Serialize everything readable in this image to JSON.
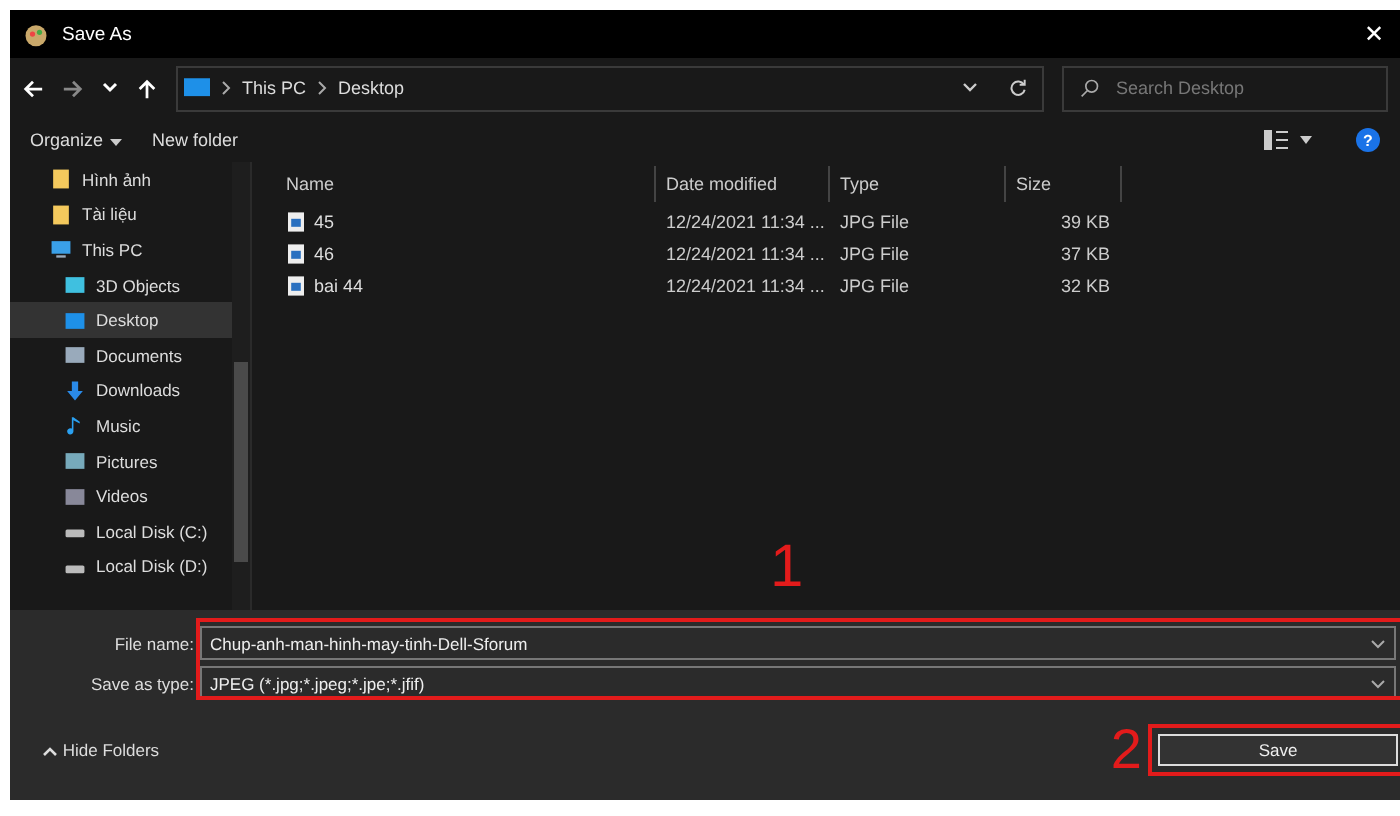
{
  "window": {
    "title": "Save As",
    "close": "✕"
  },
  "address": {
    "path": [
      "This PC",
      "Desktop"
    ],
    "search_placeholder": "Search Desktop"
  },
  "toolbar": {
    "organize": "Organize",
    "new_folder": "New folder",
    "help": "?"
  },
  "sidebar": {
    "items": [
      {
        "label": "Hình ảnh",
        "selected": false
      },
      {
        "label": "Tài liệu",
        "selected": false
      },
      {
        "label": "This PC",
        "selected": false,
        "children": [
          {
            "label": "3D Objects",
            "selected": false
          },
          {
            "label": "Desktop",
            "selected": true
          },
          {
            "label": "Documents",
            "selected": false
          },
          {
            "label": "Downloads",
            "selected": false
          },
          {
            "label": "Music",
            "selected": false
          },
          {
            "label": "Pictures",
            "selected": false
          },
          {
            "label": "Videos",
            "selected": false
          },
          {
            "label": "Local Disk (C:)",
            "selected": false
          },
          {
            "label": "Local Disk (D:)",
            "selected": false
          }
        ]
      }
    ]
  },
  "table": {
    "columns": [
      "Name",
      "Date modified",
      "Type",
      "Size"
    ],
    "rows": [
      {
        "name": "45",
        "date": "12/24/2021 11:34 ...",
        "type": "JPG File",
        "size": "39 KB"
      },
      {
        "name": "46",
        "date": "12/24/2021 11:34 ...",
        "type": "JPG File",
        "size": "37 KB"
      },
      {
        "name": "bai 44",
        "date": "12/24/2021 11:34 ...",
        "type": "JPG File",
        "size": "32 KB"
      }
    ]
  },
  "form": {
    "file_name_label": "File name:",
    "file_name": "Chup-anh-man-hinh-may-tinh-Dell-Sforum",
    "type_label": "Save as type:",
    "type_value": "JPEG (*.jpg;*.jpeg;*.jpe;*.jfif)"
  },
  "footer": {
    "hide_folders": "Hide Folders",
    "save": "Save"
  },
  "annotations": [
    {
      "number": "1"
    },
    {
      "number": "2"
    }
  ]
}
